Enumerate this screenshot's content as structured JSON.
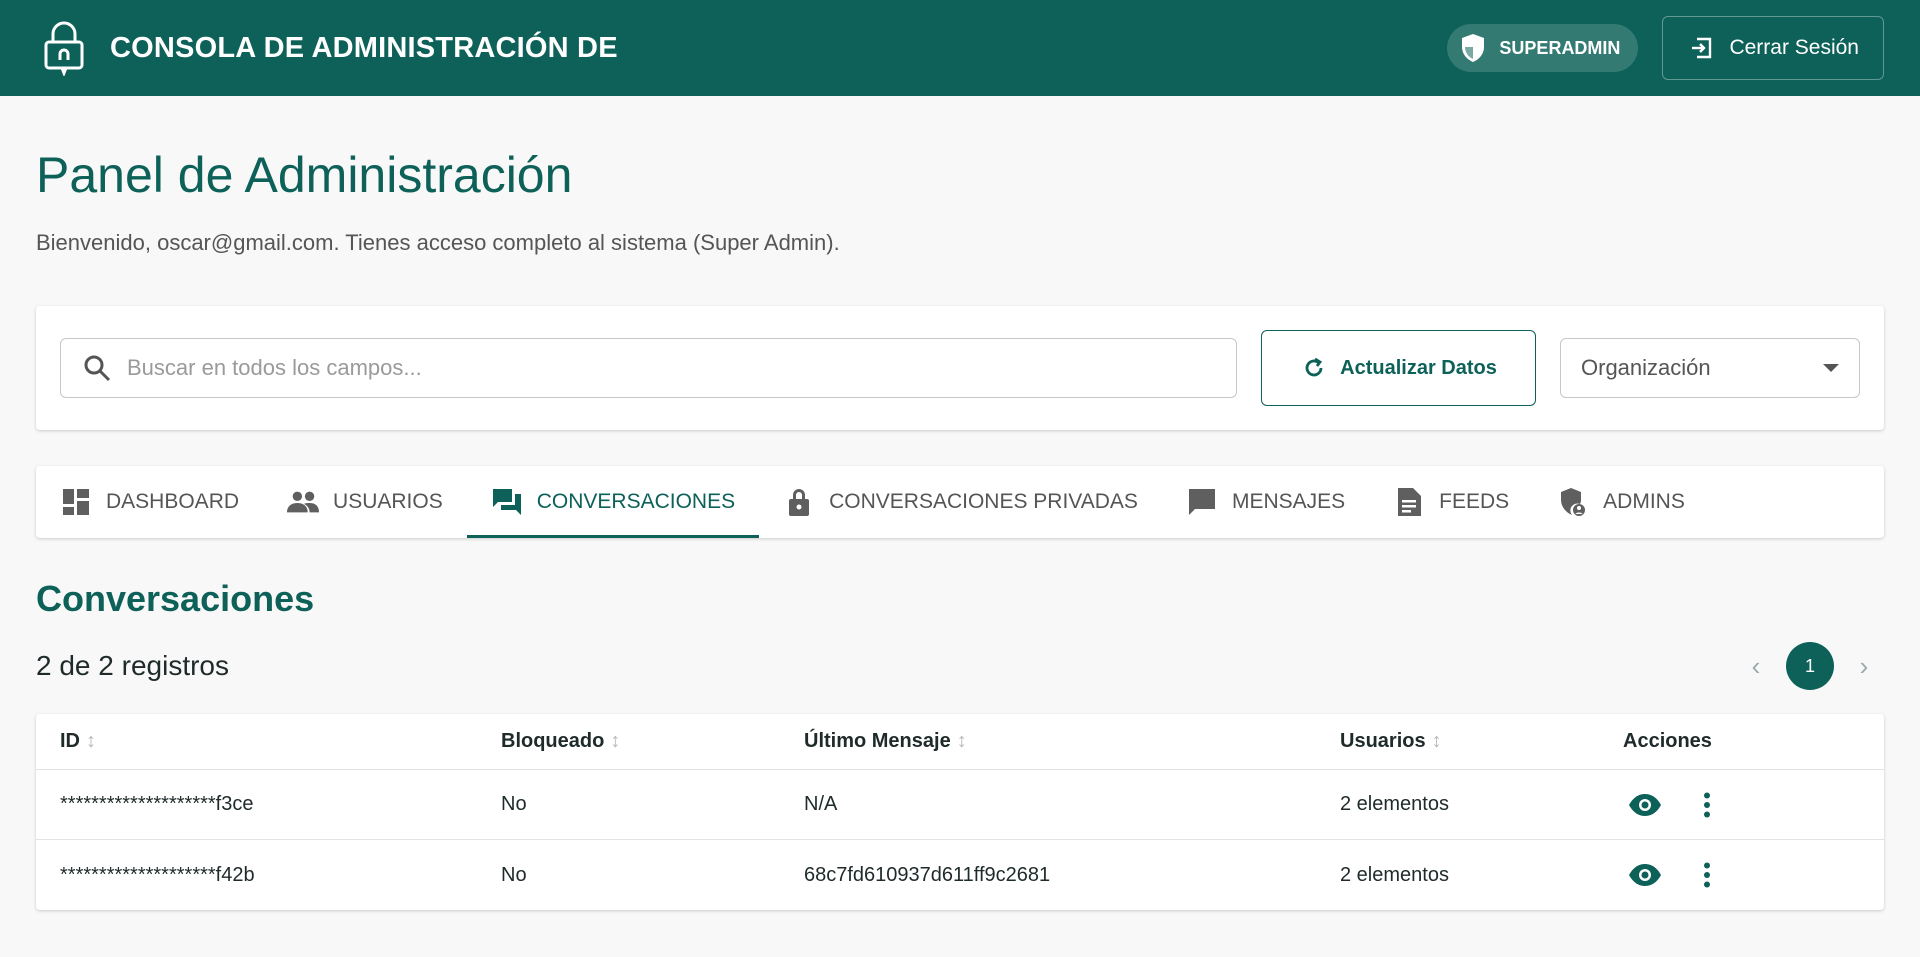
{
  "header": {
    "title": "CONSOLA DE ADMINISTRACIÓN DE",
    "role_badge": "SUPERADMIN",
    "logout_label": "Cerrar Sesión"
  },
  "page": {
    "title": "Panel de Administración",
    "subtitle": "Bienvenido, oscar@gmail.com. Tienes acceso completo al sistema (Super Admin)."
  },
  "filters": {
    "search_placeholder": "Buscar en todos los campos...",
    "refresh_label": "Actualizar Datos",
    "org_select_value": "Organización"
  },
  "tabs": [
    {
      "label": "DASHBOARD",
      "icon": "dashboard-icon"
    },
    {
      "label": "USUARIOS",
      "icon": "people-icon"
    },
    {
      "label": "CONVERSACIONES",
      "icon": "forum-icon",
      "active": true
    },
    {
      "label": "CONVERSACIONES PRIVADAS",
      "icon": "lock-icon"
    },
    {
      "label": "MENSAJES",
      "icon": "chat-icon"
    },
    {
      "label": "FEEDS",
      "icon": "article-icon"
    },
    {
      "label": "ADMINS",
      "icon": "admin-shield-icon"
    }
  ],
  "section": {
    "title": "Conversaciones",
    "records": "2 de 2 registros",
    "current_page": "1"
  },
  "table": {
    "headers": {
      "id": "ID",
      "blocked": "Bloqueado",
      "last_message": "Último Mensaje",
      "users": "Usuarios",
      "actions": "Acciones"
    },
    "rows": [
      {
        "id": "********************f3ce",
        "blocked": "No",
        "last_message": "N/A",
        "users": "2 elementos"
      },
      {
        "id": "********************f42b",
        "blocked": "No",
        "last_message": "68c7fd610937d611ff9c2681",
        "users": "2 elementos"
      }
    ]
  },
  "colors": {
    "primary": "#0d6158",
    "background": "#f8f8f8"
  }
}
